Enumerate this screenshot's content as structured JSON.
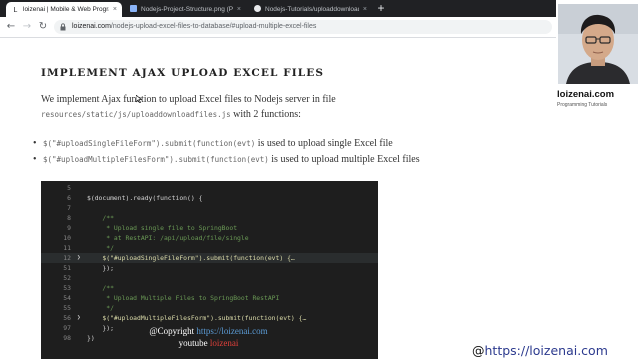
{
  "browser": {
    "tabs": [
      {
        "label": "loizenai | Mobile & Web Programming",
        "active": true
      },
      {
        "label": "Nodejs-Project-Structure.png (PNG",
        "active": false
      },
      {
        "label": "Nodejs-Tutorials/uploaddownloadfiles",
        "active": false
      }
    ],
    "close_glyph": "×",
    "new_tab_glyph": "+",
    "url_host": "loizenai.com",
    "url_path": "/nodejs-upload-excel-files-to-database/#upload-multiple-excel-files",
    "icons": [
      "back-icon",
      "forward-icon",
      "reload-icon",
      "lock-icon"
    ]
  },
  "article": {
    "heading": "IMPLEMENT AJAX UPLOAD EXCEL FILES",
    "intro_text": "We implement Ajax function to upload Excel files to Nodejs server in file",
    "intro_path": "resources/static/js/uploaddownloadfiles.js",
    "intro_suffix": "with 2 functions:",
    "bullets": [
      {
        "code": "$(\"#uploadSingleFileForm\").submit(function(evt)",
        "text": "is used to upload single Excel file"
      },
      {
        "code": "$(\"#uploadMultipleFilesForm\").submit(function(evt)",
        "text": "is used to upload multiple Excel files"
      }
    ]
  },
  "code_snippet": {
    "lines": [
      {
        "n": "5",
        "text": ""
      },
      {
        "n": "6",
        "text": "$(document).ready(function() {"
      },
      {
        "n": "7",
        "text": ""
      },
      {
        "n": "8",
        "text": "    /**"
      },
      {
        "n": "9",
        "text": "     * Upload single file to SpringBoot"
      },
      {
        "n": "10",
        "text": "     * at RestAPI: /api/upload/file/single"
      },
      {
        "n": "11",
        "text": "     */"
      },
      {
        "n": "12",
        "text": "    $(\"#uploadSingleFileForm\").submit(function(evt) {…"
      },
      {
        "n": "51",
        "text": "    });"
      },
      {
        "n": "52",
        "text": ""
      },
      {
        "n": "53",
        "text": "    /**"
      },
      {
        "n": "54",
        "text": "     * Upload Multiple Files to SpringBoot RestAPI"
      },
      {
        "n": "55",
        "text": "     */"
      },
      {
        "n": "56",
        "text": "    $(\"#uploadMultipleFilesForm\").submit(function(evt) {…"
      },
      {
        "n": "97",
        "text": "    });"
      },
      {
        "n": "98",
        "text": "})"
      }
    ],
    "watermark_prefix": "@Copyright",
    "watermark_link": "https://loizenai.com",
    "watermark_youtube": "youtube",
    "watermark_channel": "loizenai"
  },
  "presenter": {
    "brand_name": "loizenai.com",
    "brand_tagline": "Programming Tutorials"
  },
  "site_badge": {
    "at": "@",
    "url": "https://loizenai.com"
  },
  "colors": {
    "chrome_dark": "#202124",
    "code_bg": "#1e1e1e",
    "badge_blue": "#2c3a8e"
  }
}
